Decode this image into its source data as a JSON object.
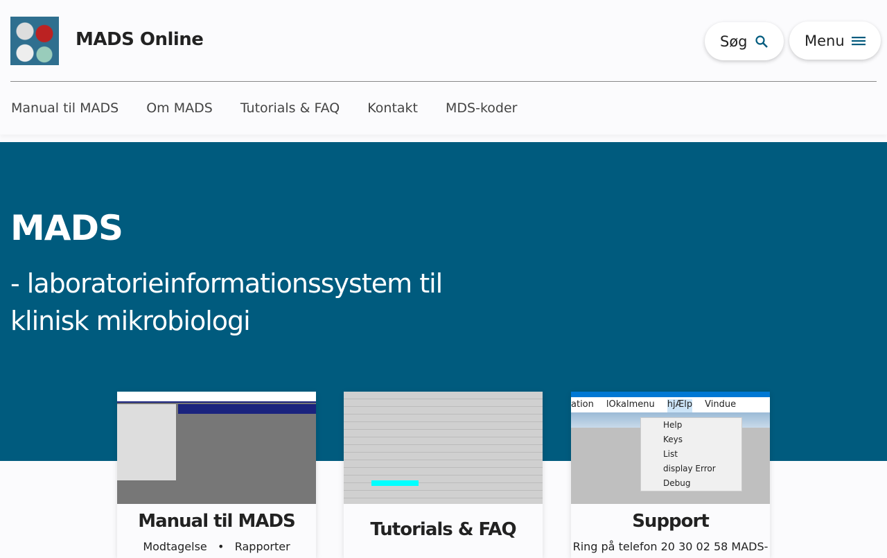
{
  "header": {
    "title": "MADS Online",
    "search_label": "Søg",
    "menu_label": "Menu"
  },
  "nav": [
    "Manual til MADS",
    "Om MADS",
    "Tutorials & FAQ",
    "Kontakt",
    "MDS-koder"
  ],
  "hero": {
    "title": "MADS",
    "subtitle": "- laboratorieinformationssystem til klinisk mikrobiologi"
  },
  "cards": [
    {
      "title": "Manual til MADS",
      "links": [
        "Modtagelse",
        "Rapporter"
      ]
    },
    {
      "title": "Tutorials & FAQ"
    },
    {
      "title": "Support",
      "text": "Ring på telefon 20 30 02 58 MADS-",
      "screenshot": {
        "menubar": [
          "ation",
          "lOkalmenu",
          "hjÆlp",
          "Vindue"
        ],
        "items": [
          "Help",
          "Keys",
          "List",
          "display Error",
          "Debug"
        ]
      }
    }
  ],
  "colors": {
    "hero": "#005b7e"
  }
}
